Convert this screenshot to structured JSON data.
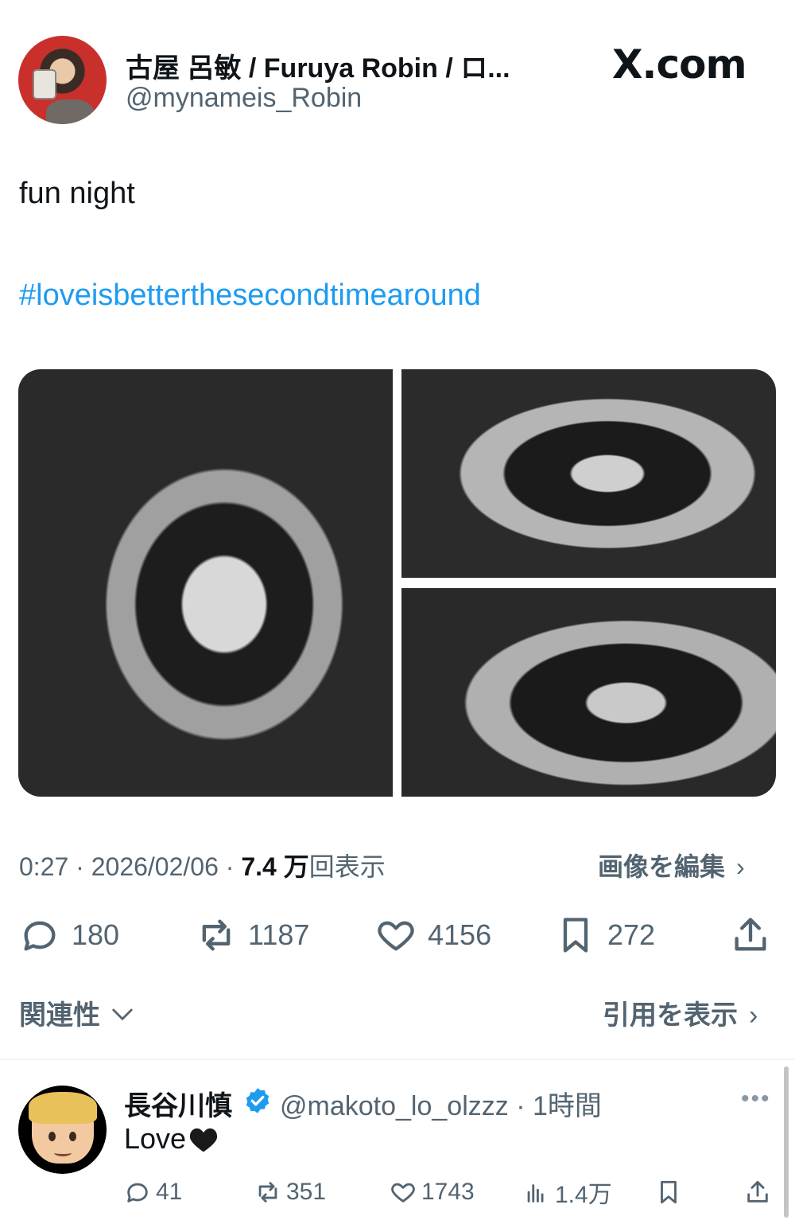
{
  "header": {
    "display_name": "古屋 呂敏 / Furuya Robin / ロ...",
    "handle": "@mynameis_Robin",
    "site_logo": "X.com"
  },
  "tweet": {
    "text": "fun night",
    "hashtag": "#loveisbetterthesecondtimearound",
    "photos": [
      "photo-1",
      "photo-2",
      "photo-3"
    ],
    "time": "0:27 · 2026/02/06 · ",
    "views_value": "7.4 万",
    "views_label": "回表示",
    "edit_image_label": "画像を編集"
  },
  "actions": {
    "replies": "180",
    "retweets": "1187",
    "likes": "4156",
    "bookmarks": "272"
  },
  "links": {
    "related": "関連性",
    "quotes": "引用を表示"
  },
  "reply": {
    "name": "長谷川慎",
    "handle": "@makoto_lo_olzzz · 1時間",
    "text": "Love",
    "replies": "41",
    "retweets": "351",
    "likes": "1743",
    "views": "1.4万"
  },
  "colors": {
    "link": "#1d9bf0",
    "secondary_text": "#536471",
    "verified": "#1d9bf0"
  }
}
